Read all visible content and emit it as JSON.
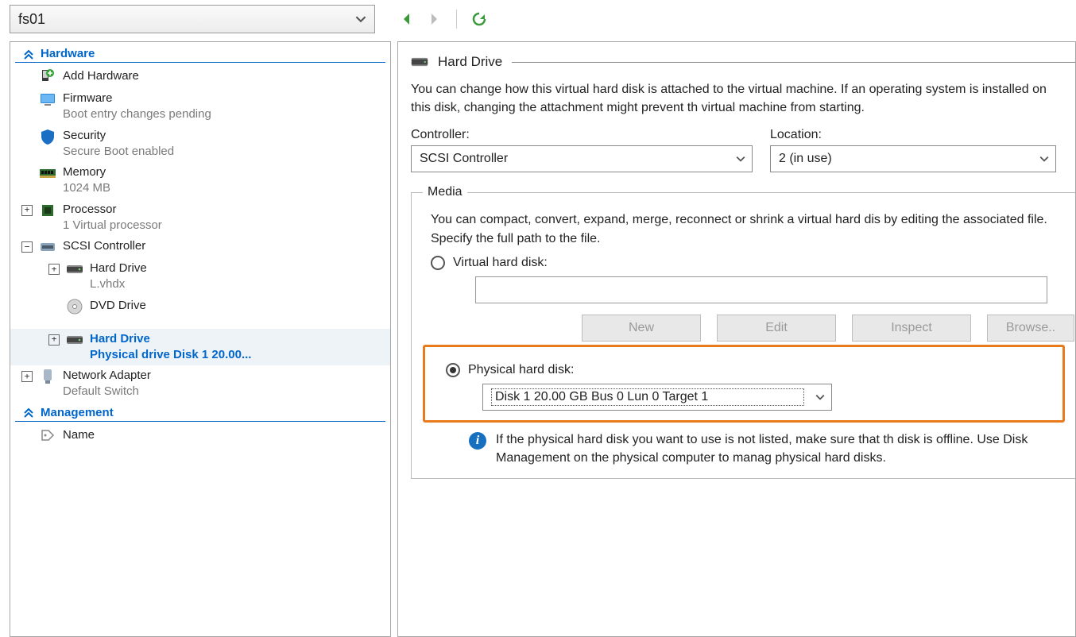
{
  "topbar": {
    "vm_name": "fs01"
  },
  "sidebar": {
    "hardware_label": "Hardware",
    "management_label": "Management",
    "items": {
      "add_hardware": "Add Hardware",
      "firmware": {
        "label": "Firmware",
        "sub": "Boot entry changes pending"
      },
      "security": {
        "label": "Security",
        "sub": "Secure Boot enabled"
      },
      "memory": {
        "label": "Memory",
        "sub": "1024 MB"
      },
      "processor": {
        "label": "Processor",
        "sub": "1 Virtual processor"
      },
      "scsi": {
        "label": "SCSI Controller"
      },
      "hd1": {
        "label": "Hard Drive",
        "sub": "L.vhdx"
      },
      "dvd": {
        "label": "DVD Drive"
      },
      "hd2": {
        "label": "Hard Drive",
        "sub": "Physical drive Disk 1 20.00..."
      },
      "net": {
        "label": "Network Adapter",
        "sub": "Default Switch"
      },
      "name": {
        "label": "Name"
      }
    }
  },
  "content": {
    "section_title": "Hard Drive",
    "intro": "You can change how this virtual hard disk is attached to the virtual machine. If an operating system is installed on this disk, changing the attachment might prevent th virtual machine from starting.",
    "controller_label": "Controller:",
    "controller_value": "SCSI Controller",
    "location_label": "Location:",
    "location_value": "2 (in use)",
    "media_legend": "Media",
    "media_intro": "You can compact, convert, expand, merge, reconnect or shrink a virtual hard dis by editing the associated file. Specify the full path to the file.",
    "vhd_label": "Virtual hard disk:",
    "vhd_path": "",
    "btn_new": "New",
    "btn_edit": "Edit",
    "btn_inspect": "Inspect",
    "btn_browse": "Browse..",
    "phys_label": "Physical hard disk:",
    "phys_value": "Disk 1 20.00 GB Bus 0 Lun 0 Target 1",
    "info_text": "If the physical hard disk you want to use is not listed, make sure that th disk is offline. Use Disk Management on the physical computer to manag physical hard disks."
  }
}
